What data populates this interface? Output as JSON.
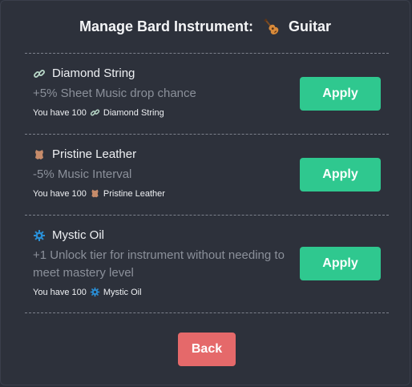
{
  "header": {
    "title": "Manage Bard Instrument:",
    "instrument_name": "Guitar",
    "instrument_icon": "guitar-icon"
  },
  "items": [
    {
      "name": "Diamond String",
      "icon": "chain-link-icon",
      "description": "+5% Sheet Music drop chance",
      "owned_prefix": "You have 100",
      "owned_name": "Diamond String",
      "apply_label": "Apply"
    },
    {
      "name": "Pristine Leather",
      "icon": "leather-hide-icon",
      "description": "-5% Music Interval",
      "owned_prefix": "You have 100",
      "owned_name": "Pristine Leather",
      "apply_label": "Apply"
    },
    {
      "name": "Mystic Oil",
      "icon": "gear-icon",
      "description": "+1 Unlock tier for instrument without needing to meet mastery level",
      "owned_prefix": "You have 100",
      "owned_name": "Mystic Oil",
      "apply_label": "Apply"
    }
  ],
  "footer": {
    "back_label": "Back"
  },
  "colors": {
    "apply": "#2fc88f",
    "back": "#e5696a",
    "background": "#2d313b"
  }
}
